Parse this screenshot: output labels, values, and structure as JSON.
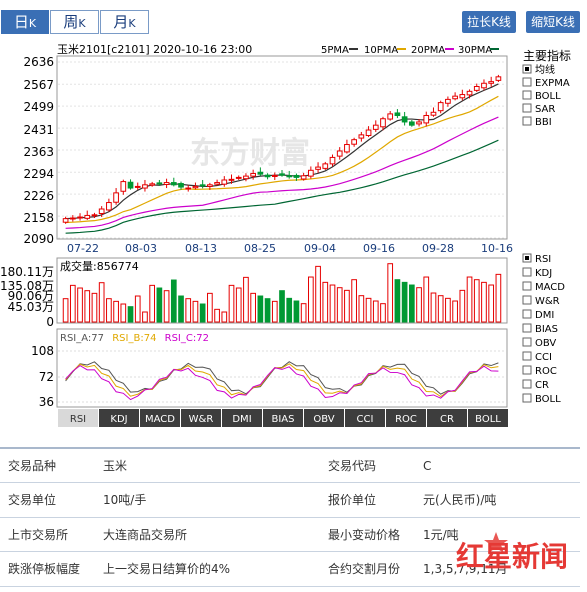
{
  "period_tabs": [
    {
      "label": "日",
      "sub": "K"
    },
    {
      "label": "周",
      "sub": "K"
    },
    {
      "label": "月",
      "sub": "K"
    }
  ],
  "tools": {
    "zoom_in": "拉长K线",
    "zoom_out": "缩短K线"
  },
  "header": {
    "title": "玉米2101[c2101] 2020-10-16 23:00",
    "ma": [
      {
        "label": "5PMA",
        "color": "#333333"
      },
      {
        "label": "10PMA",
        "color": "#e0a800"
      },
      {
        "label": "20PMA",
        "color": "#cc00cc"
      },
      {
        "label": "30PMA",
        "color": "#006633"
      }
    ]
  },
  "main_indicators": {
    "title": "主要指标",
    "items": [
      {
        "label": "均线",
        "checked": true
      },
      {
        "label": "EXPMA",
        "checked": false
      },
      {
        "label": "BOLL",
        "checked": false
      },
      {
        "label": "SAR",
        "checked": false
      },
      {
        "label": "BBI",
        "checked": false
      }
    ]
  },
  "sub_indicators": [
    {
      "label": "RSI",
      "checked": true
    },
    {
      "label": "KDJ",
      "checked": false
    },
    {
      "label": "MACD",
      "checked": false
    },
    {
      "label": "W&R",
      "checked": false
    },
    {
      "label": "DMI",
      "checked": false
    },
    {
      "label": "BIAS",
      "checked": false
    },
    {
      "label": "OBV",
      "checked": false
    },
    {
      "label": "CCI",
      "checked": false
    },
    {
      "label": "ROC",
      "checked": false
    },
    {
      "label": "CR",
      "checked": false
    },
    {
      "label": "BOLL",
      "checked": false
    }
  ],
  "bottom_tabs": [
    "RSI",
    "KDJ",
    "MACD",
    "W&R",
    "DMI",
    "BIAS",
    "OBV",
    "CCI",
    "ROC",
    "CR",
    "BOLL"
  ],
  "watermark": "东方财富",
  "chart_data": [
    {
      "type": "candlestick",
      "y_ticks": [
        "2636",
        "2567",
        "2499",
        "2431",
        "2363",
        "2294",
        "2226",
        "2158",
        "2090"
      ],
      "ylim": [
        2090,
        2636
      ],
      "x_ticks": [
        "07-22",
        "08-03",
        "08-13",
        "08-25",
        "09-04",
        "09-16",
        "09-28",
        "10-16"
      ],
      "close": [
        2150,
        2152,
        2155,
        2160,
        2162,
        2180,
        2200,
        2230,
        2265,
        2245,
        2250,
        2255,
        2258,
        2260,
        2262,
        2255,
        2248,
        2245,
        2250,
        2252,
        2255,
        2262,
        2270,
        2272,
        2278,
        2282,
        2290,
        2288,
        2280,
        2284,
        2285,
        2282,
        2278,
        2283,
        2300,
        2310,
        2320,
        2340,
        2360,
        2380,
        2395,
        2410,
        2425,
        2440,
        2460,
        2475,
        2470,
        2450,
        2440,
        2450,
        2470,
        2480,
        2510,
        2520,
        2530,
        2535,
        2545,
        2560,
        2570,
        2575,
        2590
      ]
    },
    {
      "type": "bar",
      "label": "成交量",
      "value": "856774",
      "y_ticks": [
        "180.11万",
        "135.08万",
        "90.06万",
        "45.03万",
        "0"
      ],
      "ylim": [
        0,
        1801100
      ]
    },
    {
      "type": "line",
      "series": [
        {
          "name": "RSI_A",
          "value": "77",
          "color": "#555555"
        },
        {
          "name": "RSI_B",
          "value": "74",
          "color": "#e0a800"
        },
        {
          "name": "RSI_C",
          "value": "72",
          "color": "#cc00cc"
        }
      ],
      "y_ticks": [
        "108",
        "72",
        "36"
      ],
      "ylim": [
        24,
        120
      ]
    }
  ],
  "info": [
    [
      {
        "k": "交易品种",
        "v": "玉米"
      },
      {
        "k": "交易代码",
        "v": "C"
      }
    ],
    [
      {
        "k": "交易单位",
        "v": "10吨/手"
      },
      {
        "k": "报价单位",
        "v": "元(人民币)/吨"
      }
    ],
    [
      {
        "k": "上市交易所",
        "v": "大连商品交易所"
      },
      {
        "k": "最小变动价格",
        "v": "1元/吨"
      }
    ],
    [
      {
        "k": "跌涨停板幅度",
        "v": "上一交易日结算价的4%"
      },
      {
        "k": "合约交割月份",
        "v": "1,3,5,7,9,11月"
      }
    ]
  ],
  "logo": {
    "text": "红星新闻"
  }
}
